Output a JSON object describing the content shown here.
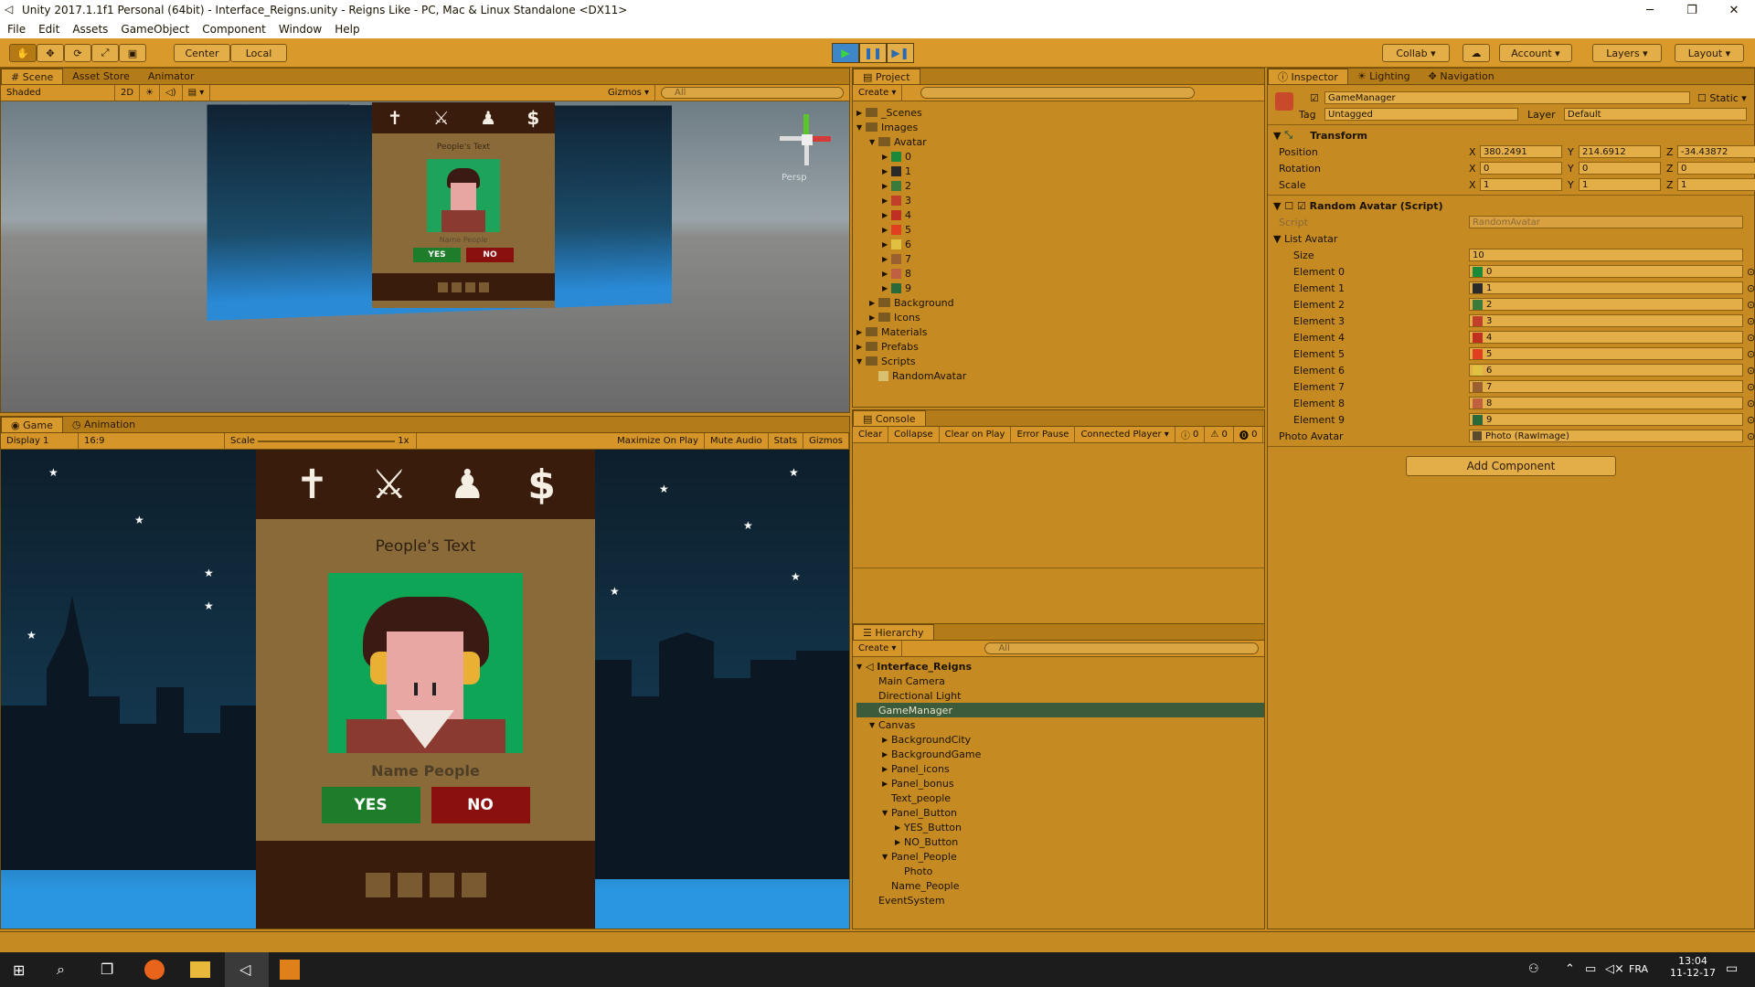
{
  "window": {
    "title": "Unity 2017.1.1f1 Personal (64bit) - Interface_Reigns.unity - Reigns Like - PC, Mac & Linux Standalone <DX11>",
    "min": "─",
    "max": "❐",
    "close": "✕"
  },
  "menu": [
    "File",
    "Edit",
    "Assets",
    "GameObject",
    "Component",
    "Window",
    "Help"
  ],
  "toolbar": {
    "center": "Center",
    "local": "Local",
    "collab": "Collab",
    "account": "Account",
    "layers": "Layers",
    "layout": "Layout"
  },
  "scene": {
    "tabs": [
      "Scene",
      "Asset Store",
      "Animator"
    ],
    "shading": "Shaded",
    "mode2d": "2D",
    "gizmos": "Gizmos",
    "search": "All",
    "persp": "Persp",
    "card_text": "People's Text",
    "name": "Name People",
    "yes": "YES",
    "no": "NO"
  },
  "game": {
    "tabs": [
      "Game",
      "Animation"
    ],
    "display": "Display 1",
    "aspect": "16:9",
    "scale_label": "Scale",
    "scale_val": "1x",
    "options": [
      "Maximize On Play",
      "Mute Audio",
      "Stats",
      "Gizmos"
    ],
    "card_text": "People's Text",
    "name": "Name People",
    "yes": "YES",
    "no": "NO"
  },
  "project": {
    "tab": "Project",
    "create": "Create",
    "tree": [
      {
        "d": 0,
        "a": "▶",
        "f": true,
        "l": "_Scenes"
      },
      {
        "d": 0,
        "a": "▼",
        "f": true,
        "l": "Images"
      },
      {
        "d": 1,
        "a": "▼",
        "f": true,
        "l": "Avatar"
      },
      {
        "d": 2,
        "a": "▶",
        "t": "#1a8a3a",
        "l": "0"
      },
      {
        "d": 2,
        "a": "▶",
        "t": "#2a2a2a",
        "l": "1"
      },
      {
        "d": 2,
        "a": "▶",
        "t": "#3a7a3a",
        "l": "2"
      },
      {
        "d": 2,
        "a": "▶",
        "t": "#c0402a",
        "l": "3"
      },
      {
        "d": 2,
        "a": "▶",
        "t": "#c03020",
        "l": "4"
      },
      {
        "d": 2,
        "a": "▶",
        "t": "#e04020",
        "l": "5"
      },
      {
        "d": 2,
        "a": "▶",
        "t": "#e0c040",
        "l": "6"
      },
      {
        "d": 2,
        "a": "▶",
        "t": "#9a6030",
        "l": "7"
      },
      {
        "d": 2,
        "a": "▶",
        "t": "#c06040",
        "l": "8"
      },
      {
        "d": 2,
        "a": "▶",
        "t": "#2a6a3a",
        "l": "9"
      },
      {
        "d": 1,
        "a": "▶",
        "f": true,
        "l": "Background"
      },
      {
        "d": 1,
        "a": "▶",
        "f": true,
        "l": "Icons"
      },
      {
        "d": 0,
        "a": "▶",
        "f": true,
        "l": "Materials"
      },
      {
        "d": 0,
        "a": "▶",
        "f": true,
        "l": "Prefabs"
      },
      {
        "d": 0,
        "a": "▼",
        "f": true,
        "l": "Scripts"
      },
      {
        "d": 1,
        "a": "",
        "t": "#d8c070",
        "l": "RandomAvatar"
      }
    ]
  },
  "console": {
    "tab": "Console",
    "buttons": [
      "Clear",
      "Collapse",
      "Clear on Play",
      "Error Pause",
      "Connected Player"
    ],
    "counts": [
      "0",
      "0",
      "0"
    ]
  },
  "hierarchy": {
    "tab": "Hierarchy",
    "create": "Create",
    "search": "All",
    "scene": "Interface_Reigns",
    "items": [
      {
        "d": 1,
        "a": "",
        "l": "Main Camera"
      },
      {
        "d": 1,
        "a": "",
        "l": "Directional Light"
      },
      {
        "d": 1,
        "a": "",
        "l": "GameManager",
        "sel": true
      },
      {
        "d": 1,
        "a": "▼",
        "l": "Canvas"
      },
      {
        "d": 2,
        "a": "▶",
        "l": "BackgroundCity"
      },
      {
        "d": 2,
        "a": "▶",
        "l": "BackgroundGame"
      },
      {
        "d": 2,
        "a": "▶",
        "l": "Panel_icons"
      },
      {
        "d": 2,
        "a": "▶",
        "l": "Panel_bonus"
      },
      {
        "d": 2,
        "a": "",
        "l": "Text_people"
      },
      {
        "d": 2,
        "a": "▼",
        "l": "Panel_Button"
      },
      {
        "d": 3,
        "a": "▶",
        "l": "YES_Button"
      },
      {
        "d": 3,
        "a": "▶",
        "l": "NO_Button"
      },
      {
        "d": 2,
        "a": "▼",
        "l": "Panel_People"
      },
      {
        "d": 3,
        "a": "",
        "l": "Photo"
      },
      {
        "d": 2,
        "a": "",
        "l": "Name_People"
      },
      {
        "d": 1,
        "a": "",
        "l": "EventSystem"
      }
    ]
  },
  "inspector": {
    "tabs": [
      "Inspector",
      "Lighting",
      "Navigation"
    ],
    "name": "GameManager",
    "static": "Static",
    "tag_label": "Tag",
    "tag": "Untagged",
    "layer_label": "Layer",
    "layer": "Default",
    "transform": {
      "title": "Transform",
      "position": [
        "380.2491",
        "214.6912",
        "-34.43872"
      ],
      "rotation": [
        "0",
        "0",
        "0"
      ],
      "scale": [
        "1",
        "1",
        "1"
      ]
    },
    "script_comp": {
      "title": "Random Avatar (Script)",
      "script_label": "Script",
      "script": "RandomAvatar",
      "list_label": "List Avatar",
      "size_label": "Size",
      "size": "10",
      "elements": [
        {
          "l": "Element 0",
          "v": "0",
          "t": "#1a8a3a"
        },
        {
          "l": "Element 1",
          "v": "1",
          "t": "#2a2a2a"
        },
        {
          "l": "Element 2",
          "v": "2",
          "t": "#3a7a3a"
        },
        {
          "l": "Element 3",
          "v": "3",
          "t": "#c0402a"
        },
        {
          "l": "Element 4",
          "v": "4",
          "t": "#c03020"
        },
        {
          "l": "Element 5",
          "v": "5",
          "t": "#e04020"
        },
        {
          "l": "Element 6",
          "v": "6",
          "t": "#e0c040"
        },
        {
          "l": "Element 7",
          "v": "7",
          "t": "#9a6030"
        },
        {
          "l": "Element 8",
          "v": "8",
          "t": "#c06040"
        },
        {
          "l": "Element 9",
          "v": "9",
          "t": "#2a6a3a"
        }
      ],
      "photo_label": "Photo Avatar",
      "photo": "Photo (RawImage)"
    },
    "add_component": "Add Component"
  },
  "taskbar": {
    "lang": "FRA",
    "time": "13:04",
    "date": "11-12-17"
  },
  "icons": {
    "card": [
      "cross-icon",
      "sword-icon",
      "person-icon",
      "dollar-icon"
    ]
  },
  "colors": {
    "accent": "#d99a2b",
    "selection": "#3b5b3a",
    "yes": "#1e7d2a",
    "no": "#8a1010"
  }
}
